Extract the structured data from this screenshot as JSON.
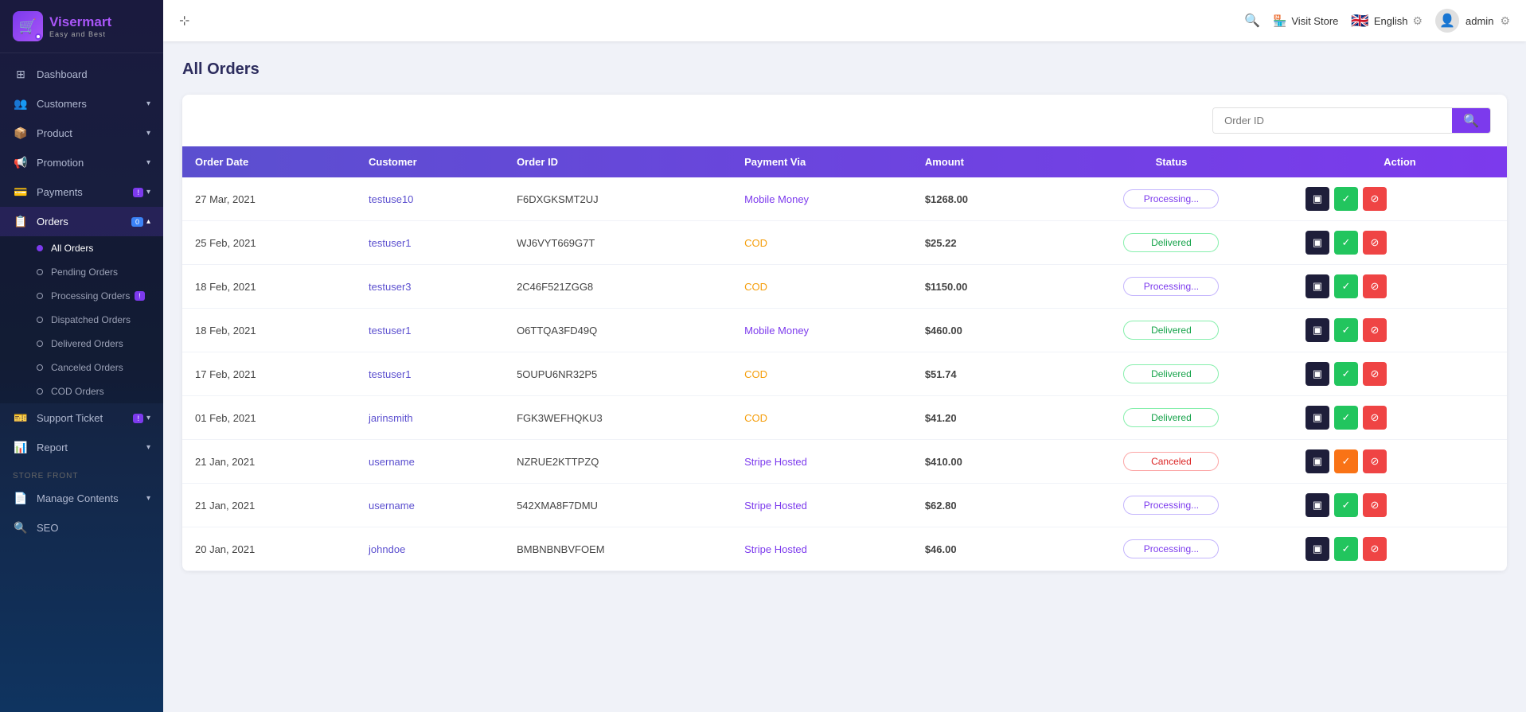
{
  "app": {
    "name_part1": "Viser",
    "name_part2": "mart",
    "tagline": "Easy and Best"
  },
  "header": {
    "visit_store_label": "Visit Store",
    "language": "English",
    "admin_name": "admin",
    "search_placeholder": "Order ID"
  },
  "sidebar": {
    "nav_items": [
      {
        "id": "dashboard",
        "label": "Dashboard",
        "icon": "⊞",
        "active": false
      },
      {
        "id": "customers",
        "label": "Customers",
        "icon": "👥",
        "has_arrow": true,
        "active": false
      },
      {
        "id": "product",
        "label": "Product",
        "icon": "📦",
        "has_arrow": true,
        "active": false
      },
      {
        "id": "promotion",
        "label": "Promotion",
        "icon": "📢",
        "has_arrow": true,
        "active": false
      },
      {
        "id": "payments",
        "label": "Payments",
        "icon": "💳",
        "has_arrow": true,
        "badge": "!",
        "active": false
      },
      {
        "id": "orders",
        "label": "Orders",
        "icon": "📋",
        "has_arrow": true,
        "badge": "0",
        "active": true
      }
    ],
    "orders_submenu": [
      {
        "id": "all-orders",
        "label": "All Orders",
        "active": true
      },
      {
        "id": "pending-orders",
        "label": "Pending Orders",
        "active": false
      },
      {
        "id": "processing-orders",
        "label": "Processing Orders",
        "badge": "!",
        "active": false
      },
      {
        "id": "dispatched-orders",
        "label": "Dispatched Orders",
        "active": false
      },
      {
        "id": "delivered-orders",
        "label": "Delivered Orders",
        "active": false
      },
      {
        "id": "canceled-orders",
        "label": "Canceled Orders",
        "active": false
      },
      {
        "id": "cod-orders",
        "label": "COD Orders",
        "active": false
      }
    ],
    "nav_items2": [
      {
        "id": "support-ticket",
        "label": "Support Ticket",
        "icon": "🎫",
        "has_arrow": true,
        "badge": "!"
      },
      {
        "id": "report",
        "label": "Report",
        "icon": "📊",
        "has_arrow": true
      }
    ],
    "section_title": "STORE FRONT",
    "nav_items3": [
      {
        "id": "manage-contents",
        "label": "Manage Contents",
        "icon": "📄",
        "has_arrow": true
      },
      {
        "id": "seo",
        "label": "SEO",
        "icon": "🔍"
      }
    ]
  },
  "page": {
    "title": "All Orders"
  },
  "table": {
    "columns": [
      "Order Date",
      "Customer",
      "Order ID",
      "Payment Via",
      "Amount",
      "Status",
      "Action"
    ],
    "rows": [
      {
        "date": "27 Mar, 2021",
        "customer": "testuse10",
        "order_id": "F6DXGKSMT2UJ",
        "payment": "Mobile Money",
        "payment_type": "purple",
        "amount": "$1268.00",
        "status": "Processing...",
        "status_type": "processing"
      },
      {
        "date": "25 Feb, 2021",
        "customer": "testuser1",
        "order_id": "WJ6VYT669G7T",
        "payment": "COD",
        "payment_type": "gold",
        "amount": "$25.22",
        "status": "Delivered",
        "status_type": "delivered"
      },
      {
        "date": "18 Feb, 2021",
        "customer": "testuser3",
        "order_id": "2C46F521ZGG8",
        "payment": "COD",
        "payment_type": "gold",
        "amount": "$1150.00",
        "status": "Processing...",
        "status_type": "processing"
      },
      {
        "date": "18 Feb, 2021",
        "customer": "testuser1",
        "order_id": "O6TTQA3FD49Q",
        "payment": "Mobile Money",
        "payment_type": "purple",
        "amount": "$460.00",
        "status": "Delivered",
        "status_type": "delivered"
      },
      {
        "date": "17 Feb, 2021",
        "customer": "testuser1",
        "order_id": "5OUPU6NR32P5",
        "payment": "COD",
        "payment_type": "gold",
        "amount": "$51.74",
        "status": "Delivered",
        "status_type": "delivered"
      },
      {
        "date": "01 Feb, 2021",
        "customer": "jarinsmith",
        "order_id": "FGK3WEFHQKU3",
        "payment": "COD",
        "payment_type": "gold",
        "amount": "$41.20",
        "status": "Delivered",
        "status_type": "delivered"
      },
      {
        "date": "21 Jan, 2021",
        "customer": "username",
        "order_id": "NZRUE2KTTPZQ",
        "payment": "Stripe Hosted",
        "payment_type": "purple",
        "amount": "$410.00",
        "status": "Canceled",
        "status_type": "canceled"
      },
      {
        "date": "21 Jan, 2021",
        "customer": "username",
        "order_id": "542XMA8F7DMU",
        "payment": "Stripe Hosted",
        "payment_type": "purple",
        "amount": "$62.80",
        "status": "Processing...",
        "status_type": "processing"
      },
      {
        "date": "20 Jan, 2021",
        "customer": "johndoe",
        "order_id": "BMBNBNBVFOEM",
        "payment": "Stripe Hosted",
        "payment_type": "purple",
        "amount": "$46.00",
        "status": "Processing...",
        "status_type": "processing"
      }
    ]
  }
}
